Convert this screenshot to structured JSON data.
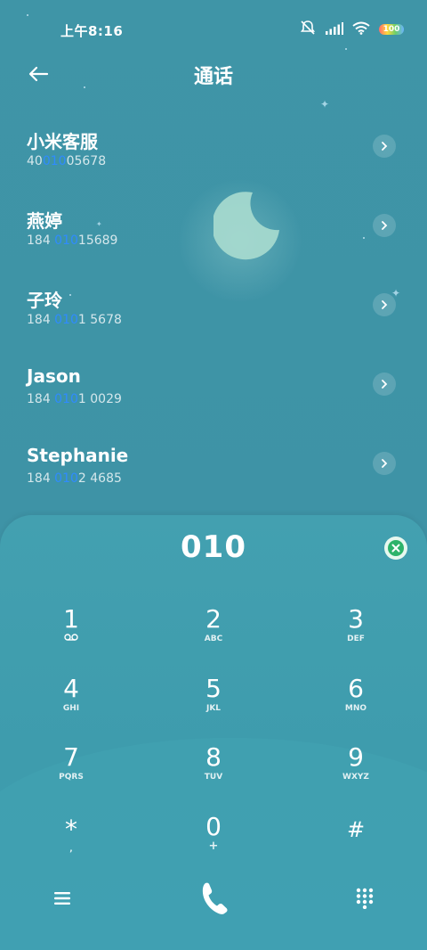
{
  "status_bar": {
    "time": "上午8:16",
    "battery": "100",
    "icons": [
      "mute-icon",
      "signal-icon",
      "wifi-icon",
      "battery-icon"
    ]
  },
  "header": {
    "title": "通话",
    "back_icon": "arrow-left-icon"
  },
  "contacts": [
    {
      "name": "小米客服",
      "number_pre": "40",
      "number_match": "010",
      "number_post": "05678"
    },
    {
      "name": "燕婷",
      "number_pre": "184 ",
      "number_match": "010",
      "number_post": "15689"
    },
    {
      "name": "子玲",
      "number_pre": "184 ",
      "number_match": "010",
      "number_post": "1 5678"
    },
    {
      "name": "Jason",
      "number_pre": "184 ",
      "number_match": "010",
      "number_post": "1 0029"
    },
    {
      "name": "Stephanie",
      "number_pre": "184 ",
      "number_match": "010",
      "number_post": "2 4685"
    }
  ],
  "dialer": {
    "input": "010",
    "keys": [
      {
        "num": "1",
        "sub": ""
      },
      {
        "num": "2",
        "sub": "ABC"
      },
      {
        "num": "3",
        "sub": "DEF"
      },
      {
        "num": "4",
        "sub": "GHI"
      },
      {
        "num": "5",
        "sub": "JKL"
      },
      {
        "num": "6",
        "sub": "MNO"
      },
      {
        "num": "7",
        "sub": "PQRS"
      },
      {
        "num": "8",
        "sub": "TUV"
      },
      {
        "num": "9",
        "sub": "WXYZ"
      },
      {
        "num": "*",
        "sub": ","
      },
      {
        "num": "0",
        "sub": "+"
      },
      {
        "num": "#",
        "sub": ""
      }
    ]
  },
  "bottom_bar": {
    "menu_icon": "menu-icon",
    "call_icon": "phone-icon",
    "keypad_icon": "dialpad-icon"
  },
  "colors": {
    "background": "#3f95a7",
    "panel": "#43a0b0",
    "match_highlight": "#2f8bff",
    "clear_button": "#2db36a"
  }
}
